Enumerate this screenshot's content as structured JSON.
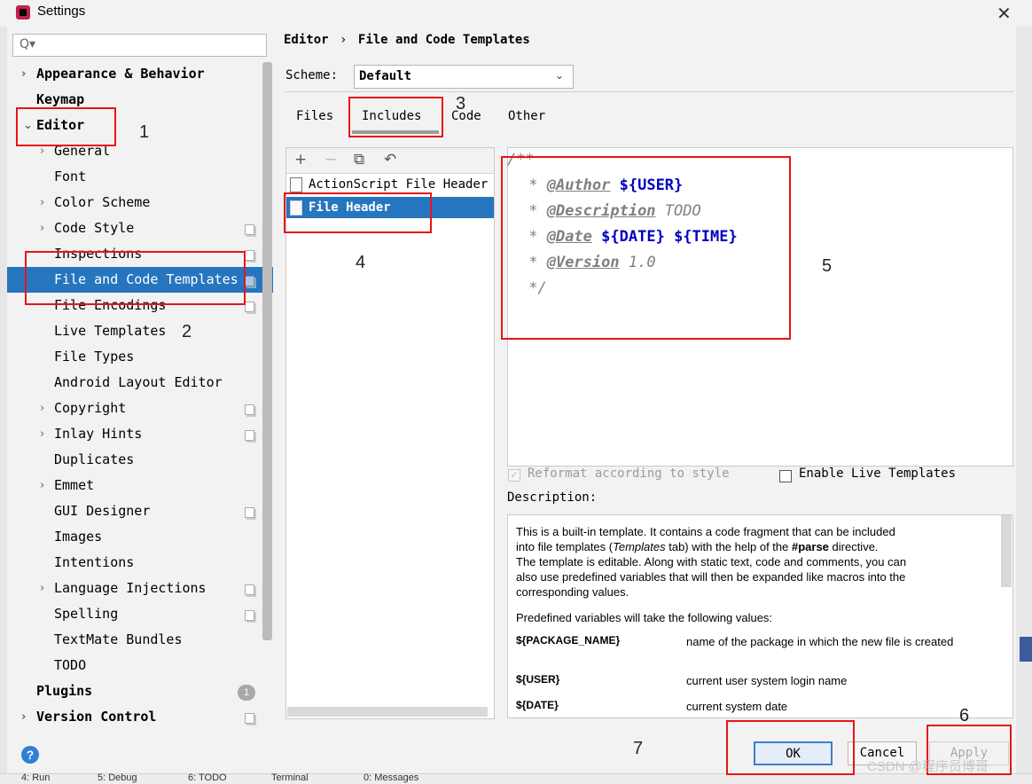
{
  "window": {
    "title": "Settings"
  },
  "sidebar": {
    "search_placeholder": "Q▾",
    "items": [
      {
        "label": "Appearance & Behavior"
      },
      {
        "label": "Keymap"
      },
      {
        "label": "Editor"
      },
      {
        "label": "General"
      },
      {
        "label": "Font"
      },
      {
        "label": "Color Scheme"
      },
      {
        "label": "Code Style"
      },
      {
        "label": "Inspections"
      },
      {
        "label": "File and Code Templates"
      },
      {
        "label": "File Encodings"
      },
      {
        "label": "Live Templates"
      },
      {
        "label": "File Types"
      },
      {
        "label": "Android Layout Editor"
      },
      {
        "label": "Copyright"
      },
      {
        "label": "Inlay Hints"
      },
      {
        "label": "Duplicates"
      },
      {
        "label": "Emmet"
      },
      {
        "label": "GUI Designer"
      },
      {
        "label": "Images"
      },
      {
        "label": "Intentions"
      },
      {
        "label": "Language Injections"
      },
      {
        "label": "Spelling"
      },
      {
        "label": "TextMate Bundles"
      },
      {
        "label": "TODO"
      },
      {
        "label": "Plugins"
      },
      {
        "label": "Version Control"
      }
    ],
    "plugins_badge": "1"
  },
  "breadcrumb": {
    "parent": "Editor",
    "separator": "›",
    "current": "File and Code Templates"
  },
  "scheme": {
    "label": "Scheme:",
    "value": "Default"
  },
  "tabs": [
    {
      "label": "Files"
    },
    {
      "label": "Includes"
    },
    {
      "label": "Code"
    },
    {
      "label": "Other"
    }
  ],
  "templates": {
    "items": [
      {
        "label": "ActionScript File Header",
        "icon_text": "AS"
      },
      {
        "label": "File Header",
        "icon_text": "J"
      }
    ]
  },
  "editor": {
    "line1": "/**",
    "line2_prefix": " * ",
    "line2_tag": "@Author",
    "line2_var": "${USER}",
    "line3_prefix": " * ",
    "line3_tag": "@Description",
    "line3_text": "TODO",
    "line4_prefix": " * ",
    "line4_tag": "@Date",
    "line4_var1": "${DATE}",
    "line4_var2": "${TIME}",
    "line5_prefix": " * ",
    "line5_tag": "@Version",
    "line5_text": "1.0",
    "line6": " */"
  },
  "options": {
    "reformat_label": "Reformat according to style",
    "reformat_checked": true,
    "live_templates_label": "Enable Live Templates",
    "live_templates_checked": false
  },
  "description": {
    "label": "Description:",
    "p1_a": "This is a built-in template. It contains a code fragment that can be included",
    "p1_b": "into file templates (",
    "p1_templates": "Templates",
    "p1_c": " tab) with the help of the ",
    "p1_parse": "#parse",
    "p1_d": " directive.",
    "p1_e": "The template is editable. Along with static text, code and comments, you can",
    "p1_f": "also use predefined variables that will then be expanded like macros into the",
    "p1_g": "corresponding values.",
    "p2": "Predefined variables will take the following values:",
    "vars": [
      {
        "name": "${PACKAGE_NAME}",
        "desc": "name of the package in which the new file is created"
      },
      {
        "name": "${USER}",
        "desc": "current user system login name"
      },
      {
        "name": "${DATE}",
        "desc": "current system date"
      }
    ]
  },
  "buttons": {
    "ok": "OK",
    "cancel": "Cancel",
    "apply": "Apply",
    "help": "?"
  },
  "statusbar": [
    {
      "label": "4: Run"
    },
    {
      "label": "5: Debug"
    },
    {
      "label": "6: TODO"
    },
    {
      "label": "Terminal"
    },
    {
      "label": "0: Messages"
    }
  ],
  "annotations": {
    "n1": "1",
    "n2": "2",
    "n3": "3",
    "n4": "4",
    "n5": "5",
    "n6": "6",
    "n7": "7"
  },
  "watermark": "CSDN @程序员博哥",
  "colors": {
    "selection": "#2675bf",
    "annotation_box": "#e8141a",
    "code_variable": "#0000c0"
  }
}
